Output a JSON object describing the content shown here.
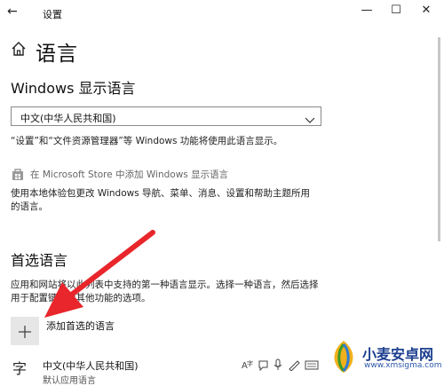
{
  "window": {
    "title": "设置",
    "back_glyph": "←",
    "minimize_glyph": "—",
    "maximize_glyph": "☐",
    "close_glyph": "✕"
  },
  "page": {
    "title": "语言"
  },
  "display_language": {
    "heading": "Windows 显示语言",
    "selected": "中文(中华人民共和国)",
    "description": "“设置”和“文件资源管理器”等 Windows 功能将使用此语言显示。",
    "store_link": "在 Microsoft Store 中添加 Windows 显示语言",
    "store_description_1": "使用本地体验包更改 Windows 导航、菜单、消息、设置和帮助主题所用",
    "store_description_2": "的语言。"
  },
  "preferred": {
    "heading": "首选语言",
    "description_1": "应用和网站将以此列表中支持的第一种语言显示。选择一种语言，然后选择",
    "description_2": "用于配置键盘和其他功能的选项。",
    "add_label": "添加首选的语言",
    "add_glyph": "+",
    "items": [
      {
        "icon_glyph": "字",
        "name": "中文(中华人民共和国)",
        "subtitle": "默认应用语言"
      }
    ]
  },
  "watermark": {
    "brand": "小麦安卓网",
    "url": "www.xmsigma.com"
  },
  "colors": {
    "accent_arrow": "#e8262b",
    "watermark_blue": "#1d3f8f"
  }
}
